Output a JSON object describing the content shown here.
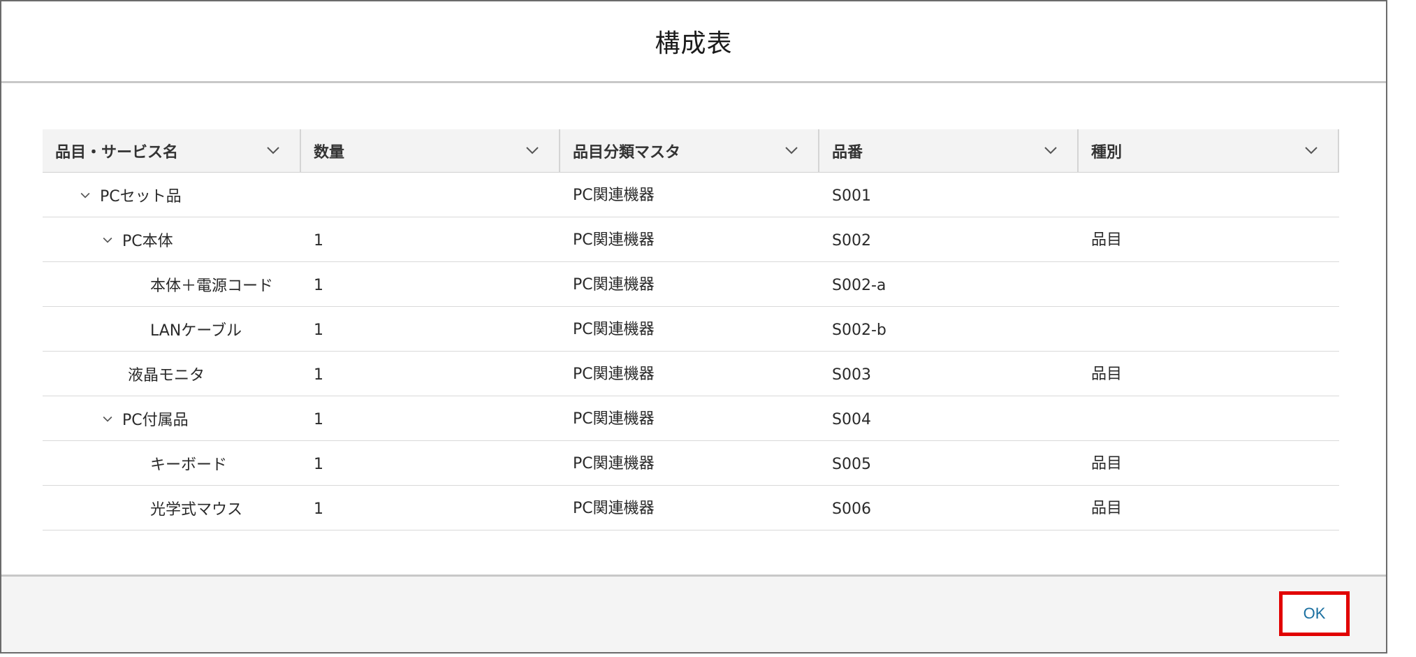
{
  "dialog": {
    "title": "構成表"
  },
  "table": {
    "columns": [
      {
        "label": "品目・サービス名"
      },
      {
        "label": "数量"
      },
      {
        "label": "品目分類マスタ"
      },
      {
        "label": "品番"
      },
      {
        "label": "種別"
      }
    ],
    "rows": [
      {
        "name": "PCセット品",
        "qty": "",
        "category": "PC関連機器",
        "code": "S001",
        "kind": "",
        "level": 1,
        "expandable": true
      },
      {
        "name": "PC本体",
        "qty": "1",
        "category": "PC関連機器",
        "code": "S002",
        "kind": "品目",
        "level": 2,
        "expandable": true
      },
      {
        "name": "本体＋電源コード",
        "qty": "1",
        "category": "PC関連機器",
        "code": "S002-a",
        "kind": "",
        "level": 3,
        "expandable": false
      },
      {
        "name": "LANケーブル",
        "qty": "1",
        "category": "PC関連機器",
        "code": "S002-b",
        "kind": "",
        "level": 3,
        "expandable": false
      },
      {
        "name": "液晶モニタ",
        "qty": "1",
        "category": "PC関連機器",
        "code": "S003",
        "kind": "品目",
        "level": 2,
        "expandable": false
      },
      {
        "name": "PC付属品",
        "qty": "1",
        "category": "PC関連機器",
        "code": "S004",
        "kind": "",
        "level": 2,
        "expandable": true
      },
      {
        "name": "キーボード",
        "qty": "1",
        "category": "PC関連機器",
        "code": "S005",
        "kind": "品目",
        "level": 3,
        "expandable": false
      },
      {
        "name": "光学式マウス",
        "qty": "1",
        "category": "PC関連機器",
        "code": "S006",
        "kind": "品目",
        "level": 3,
        "expandable": false
      }
    ]
  },
  "footer": {
    "ok_label": "OK"
  },
  "icons": {
    "sort": "chevron-down-icon",
    "expand": "chevron-down-icon"
  },
  "colors": {
    "highlight_border": "#e10000",
    "ok_text": "#1a6fa0",
    "header_bg": "#f3f3f3",
    "footer_bg": "#f4f4f4"
  }
}
